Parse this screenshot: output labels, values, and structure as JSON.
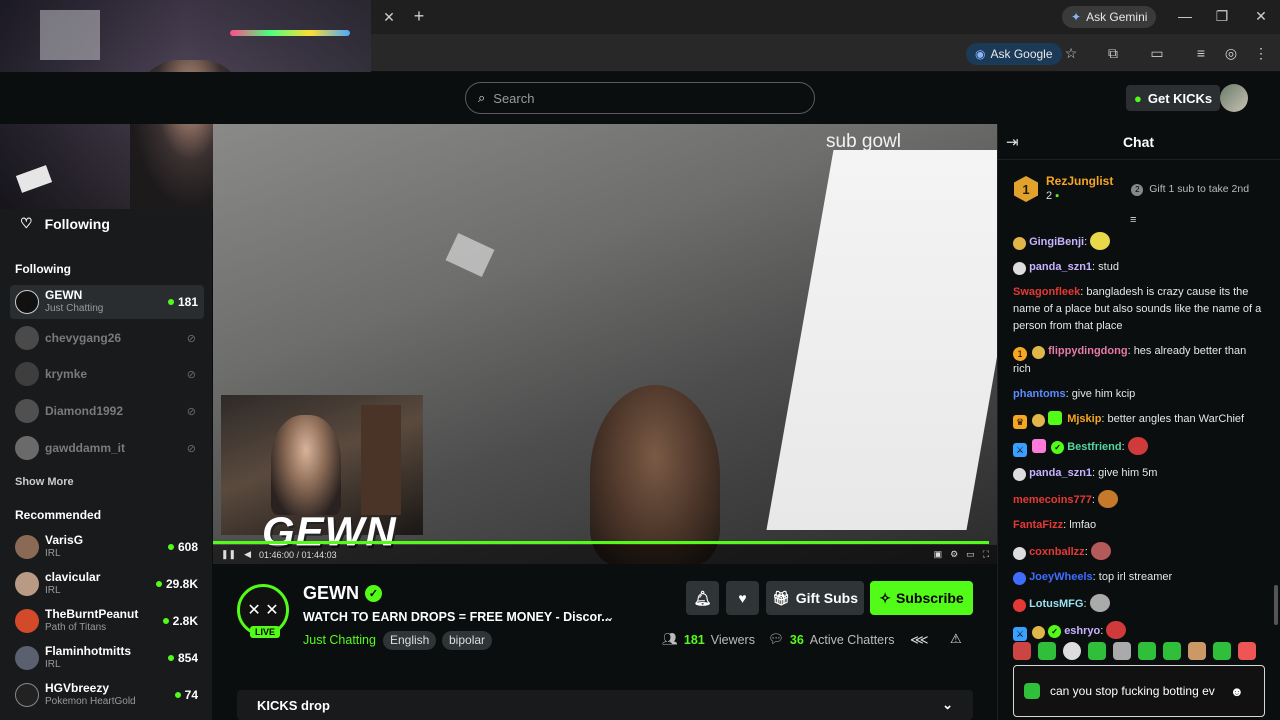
{
  "browser": {
    "close_tab": "✕",
    "new_tab": "+",
    "ask_gemini": "Ask Gemini",
    "ask_google": "Ask Google"
  },
  "header": {
    "search_placeholder": "Search",
    "get_kicks": "Get KICKs"
  },
  "sidebar": {
    "following_header": "Following",
    "following_section": "Following",
    "following": [
      {
        "name": "GEWN",
        "category": "Just Chatting",
        "viewers": "181",
        "live": true
      },
      {
        "name": "chevygang26",
        "live": false
      },
      {
        "name": "krymke",
        "live": false
      },
      {
        "name": "Diamond1992",
        "live": false
      },
      {
        "name": "gawddamm_it",
        "live": false
      }
    ],
    "show_more": "Show More",
    "recommended_section": "Recommended",
    "recommended": [
      {
        "name": "VarisG",
        "category": "IRL",
        "viewers": "608"
      },
      {
        "name": "clavicular",
        "category": "IRL",
        "viewers": "29.8K"
      },
      {
        "name": "TheBurntPeanut",
        "category": "Path of Titans",
        "viewers": "2.8K"
      },
      {
        "name": "Flaminhotmitts",
        "category": "IRL",
        "viewers": "854"
      },
      {
        "name": "HGVbreezy",
        "category": "Pokemon HeartGold",
        "viewers": "74"
      }
    ]
  },
  "video": {
    "overlay_text": "sub gowl",
    "logo_text": "GEWN",
    "time": "01:46:00 / 01:44:03",
    "progress": 0.99
  },
  "stream": {
    "channel": "GEWN",
    "live_label": "LIVE",
    "title": "WATCH TO EARN DROPS = FREE MONEY - Discor...",
    "category": "Just Chatting",
    "tags": [
      "English",
      "bipolar"
    ],
    "gift_subs": "Gift Subs",
    "subscribe": "Subscribe",
    "viewers_count": "181",
    "viewers_label": "Viewers",
    "chatters_count": "36",
    "chatters_label": "Active Chatters",
    "drops_label": "KICKS drop"
  },
  "chat": {
    "title": "Chat",
    "pinned": {
      "rank": "1",
      "user": "RezJunglist",
      "count": "2",
      "cta": "Gift 1 sub to take 2nd",
      "cta_badge": "2"
    },
    "messages": [
      {
        "user": "GingiBenji",
        "color": "#c9b2ff",
        "text": ""
      },
      {
        "user": "panda_szn1",
        "color": "#c9b2ff",
        "text": "stud"
      },
      {
        "user": "Swagonfleek",
        "color": "#e53935",
        "text": "bangladesh is crazy cause its the name of a place but also sounds like the name of a person from that place"
      },
      {
        "user": "flippydingdong",
        "color": "#e67aa8",
        "text": "hes already better than rich"
      },
      {
        "user": "phantoms",
        "color": "#5b8cff",
        "text": "give him kcip"
      },
      {
        "user": "Mjskip",
        "color": "#f5a623",
        "text": "better angles than WarChief"
      },
      {
        "user": "Bestfriend",
        "color": "#53d6a0",
        "text": ""
      },
      {
        "user": "panda_szn1",
        "color": "#c9b2ff",
        "text": "give him 5m"
      },
      {
        "user": "memecoins777",
        "color": "#e53935",
        "text": ""
      },
      {
        "user": "FantaFizz",
        "color": "#e53935",
        "text": "lmfao"
      },
      {
        "user": "coxnballzz",
        "color": "#e53935",
        "text": ""
      },
      {
        "user": "JoeyWheels",
        "color": "#3f6dff",
        "text": "top irl streamer"
      },
      {
        "user": "LotusMFG",
        "color": "#9be0f0",
        "text": ""
      },
      {
        "user": "eshryo",
        "color": "#c9b2ff",
        "text": ""
      }
    ],
    "input_text": "can you stop fucking botting ev"
  },
  "colors": {
    "accent": "#53fc18",
    "bg": "#0b0e0f",
    "sidebar": "#181a1b"
  }
}
